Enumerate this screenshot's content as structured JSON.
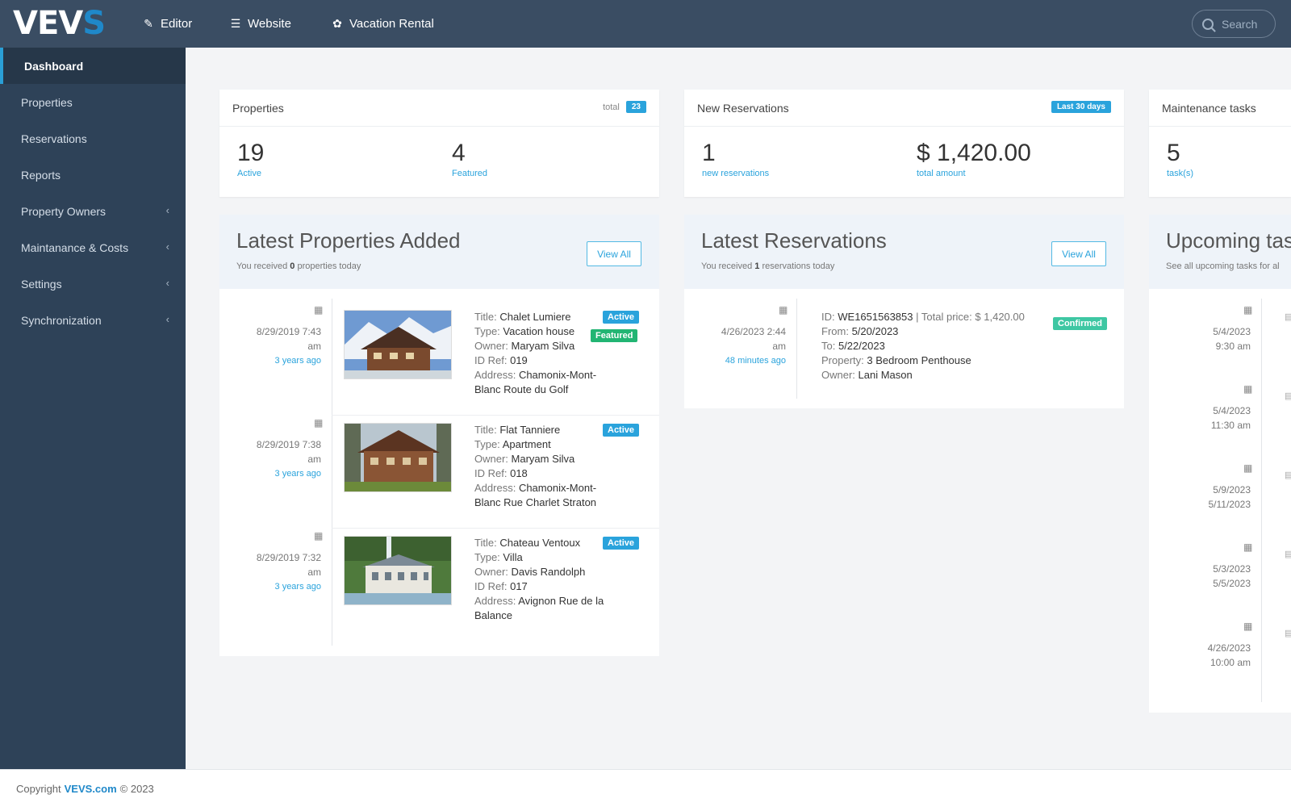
{
  "app": {
    "logo_main": "VEV",
    "logo_accent": "S"
  },
  "topnav": [
    {
      "icon": "pencil-icon",
      "glyph": "✎",
      "label": "Editor"
    },
    {
      "icon": "list-icon",
      "glyph": "☰",
      "label": "Website"
    },
    {
      "icon": "gear-icon",
      "glyph": "✿",
      "label": "Vacation Rental"
    }
  ],
  "search": {
    "placeholder": "Search"
  },
  "sidebar": {
    "items": [
      {
        "label": "Dashboard",
        "active": true
      },
      {
        "label": "Properties"
      },
      {
        "label": "Reservations"
      },
      {
        "label": "Reports"
      },
      {
        "label": "Property Owners",
        "expandable": true
      },
      {
        "label": "Maintanance & Costs",
        "expandable": true
      },
      {
        "label": "Settings",
        "expandable": true
      },
      {
        "label": "Synchronization",
        "expandable": true
      }
    ]
  },
  "stats": {
    "properties": {
      "title": "Properties",
      "total_label": "total",
      "total": "23",
      "active": "19",
      "active_label": "Active",
      "featured": "4",
      "featured_label": "Featured"
    },
    "reservations": {
      "title": "New Reservations",
      "badge": "Last 30 days",
      "count": "1",
      "count_label": "new reservations",
      "amount": "$ 1,420.00",
      "amount_label": "total amount"
    },
    "maintenance": {
      "title": "Maintenance tasks",
      "count": "5",
      "count_label": "task(s)"
    }
  },
  "latest_properties": {
    "title": "Latest Properties Added",
    "sub_prefix": "You received",
    "sub_count": "0",
    "sub_suffix": "properties today",
    "view_all": "View All",
    "items": [
      {
        "date": "8/29/2019 7:43",
        "ampm": "am",
        "ago": "3 years ago",
        "title_label": "Title:",
        "title": "Chalet Lumiere",
        "type_label": "Type:",
        "type": "Vacation house",
        "owner_label": "Owner:",
        "owner": "Maryam Silva",
        "id_label": "ID Ref:",
        "id": "019",
        "address_label": "Address:",
        "address1": "Chamonix-Mont-",
        "address2": "Blanc Route du Golf",
        "status": "Active",
        "featured": "Featured"
      },
      {
        "date": "8/29/2019 7:38",
        "ampm": "am",
        "ago": "3 years ago",
        "title_label": "Title:",
        "title": "Flat Tanniere",
        "type_label": "Type:",
        "type": "Apartment",
        "owner_label": "Owner:",
        "owner": "Maryam Silva",
        "id_label": "ID Ref:",
        "id": "018",
        "address_label": "Address:",
        "address1": "Chamonix-Mont-",
        "address2": "Blanc Rue Charlet Straton",
        "status": "Active"
      },
      {
        "date": "8/29/2019 7:32",
        "ampm": "am",
        "ago": "3 years ago",
        "title_label": "Title:",
        "title": "Chateau Ventoux",
        "type_label": "Type:",
        "type": "Villa",
        "owner_label": "Owner:",
        "owner": "Davis Randolph",
        "id_label": "ID Ref:",
        "id": "017",
        "address_label": "Address:",
        "address1": "Avignon Rue de la",
        "address2": "Balance",
        "status": "Active"
      }
    ]
  },
  "latest_reservations": {
    "title": "Latest Reservations",
    "sub_prefix": "You received",
    "sub_count": "1",
    "sub_suffix": "reservations today",
    "view_all": "View All",
    "items": [
      {
        "date": "4/26/2023 2:44",
        "ampm": "am",
        "ago": "48 minutes ago",
        "id_label": "ID:",
        "id": "WE1651563853",
        "sep": "|",
        "price_label": "Total price:",
        "price": "$ 1,420.00",
        "from_label": "From:",
        "from": "5/20/2023",
        "to_label": "To:",
        "to": "5/22/2023",
        "property_label": "Property:",
        "property": "3 Bedroom Penthouse",
        "owner_label": "Owner:",
        "owner": "Lani Mason",
        "status": "Confirmed"
      }
    ]
  },
  "upcoming_tasks": {
    "title": "Upcoming tas",
    "sub": "See all upcoming tasks for al",
    "items": [
      {
        "line1": "5/4/2023",
        "line2": "9:30 am"
      },
      {
        "line1": "5/4/2023",
        "line2": "11:30 am"
      },
      {
        "line1": "5/9/2023",
        "line2": "5/11/2023"
      },
      {
        "line1": "5/3/2023",
        "line2": "5/5/2023"
      },
      {
        "line1": "4/26/2023",
        "line2": "10:00 am"
      }
    ]
  },
  "footer": {
    "prefix": "Copyright",
    "brand": "VEVS.com",
    "suffix": "© 2023"
  },
  "colors": {
    "topbar": "#3a4d63",
    "sidebar": "#2e4258",
    "accent": "#2aa3dc",
    "featured": "#22b573",
    "confirmed": "#3ec7a3"
  }
}
